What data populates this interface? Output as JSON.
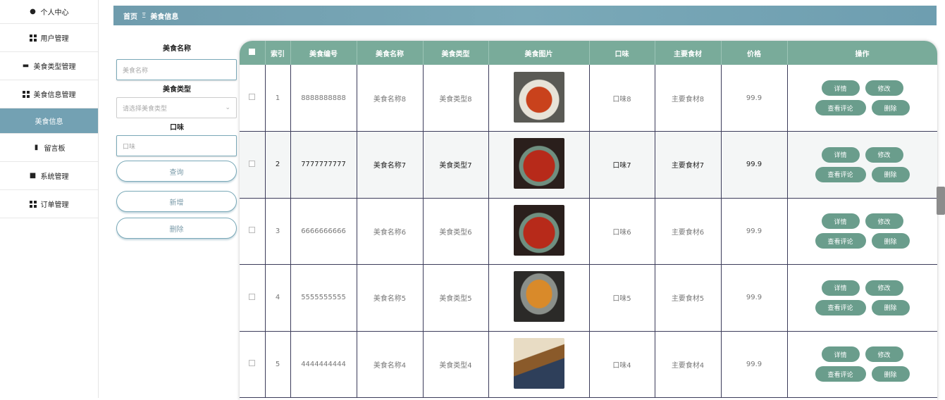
{
  "sidebar": {
    "items": [
      {
        "label": "个人中心",
        "icon": "user-icon"
      },
      {
        "label": "用户管理",
        "icon": "grid-icon"
      },
      {
        "label": "美食类型管理",
        "icon": "monitor-icon"
      },
      {
        "label": "美食信息管理",
        "icon": "grid-icon"
      },
      {
        "label": "美食信息",
        "icon": "",
        "active": true
      },
      {
        "label": "留言板",
        "icon": "chart-icon"
      },
      {
        "label": "系统管理",
        "icon": "clipboard-icon"
      },
      {
        "label": "订单管理",
        "icon": "grid-icon"
      }
    ]
  },
  "breadcrumb": {
    "home": "首页",
    "separator": "Ξ",
    "current": "美食信息"
  },
  "search": {
    "name_label": "美食名称",
    "name_placeholder": "美食名称",
    "type_label": "美食类型",
    "type_placeholder": "请选择美食类型",
    "taste_label": "口味",
    "taste_placeholder": "口味",
    "query_button": "查询",
    "add_button": "新增",
    "delete_button": "删除"
  },
  "table": {
    "headers": [
      "索引",
      "美食编号",
      "美食名称",
      "美食类型",
      "美食图片",
      "口味",
      "主要食材",
      "价格",
      "操作"
    ],
    "rows": [
      {
        "index": "1",
        "code": "8888888888",
        "name": "美食名称8",
        "type": "美食类型8",
        "taste": "口味8",
        "ingredient": "主要食材8",
        "price": "99.9"
      },
      {
        "index": "2",
        "code": "7777777777",
        "name": "美食名称7",
        "type": "美食类型7",
        "taste": "口味7",
        "ingredient": "主要食材7",
        "price": "99.9"
      },
      {
        "index": "3",
        "code": "6666666666",
        "name": "美食名称6",
        "type": "美食类型6",
        "taste": "口味6",
        "ingredient": "主要食材6",
        "price": "99.9"
      },
      {
        "index": "4",
        "code": "5555555555",
        "name": "美食名称5",
        "type": "美食类型5",
        "taste": "口味5",
        "ingredient": "主要食材5",
        "price": "99.9"
      },
      {
        "index": "5",
        "code": "4444444444",
        "name": "美食名称4",
        "type": "美食类型4",
        "taste": "口味4",
        "ingredient": "主要食材4",
        "price": "99.9"
      }
    ],
    "actions": {
      "detail": "详情",
      "edit": "修改",
      "comments": "查看评论",
      "delete": "删除"
    }
  },
  "colors": {
    "accent": "#73a1b3",
    "table_header": "#79ab9a",
    "button": "#6a9d8c"
  }
}
